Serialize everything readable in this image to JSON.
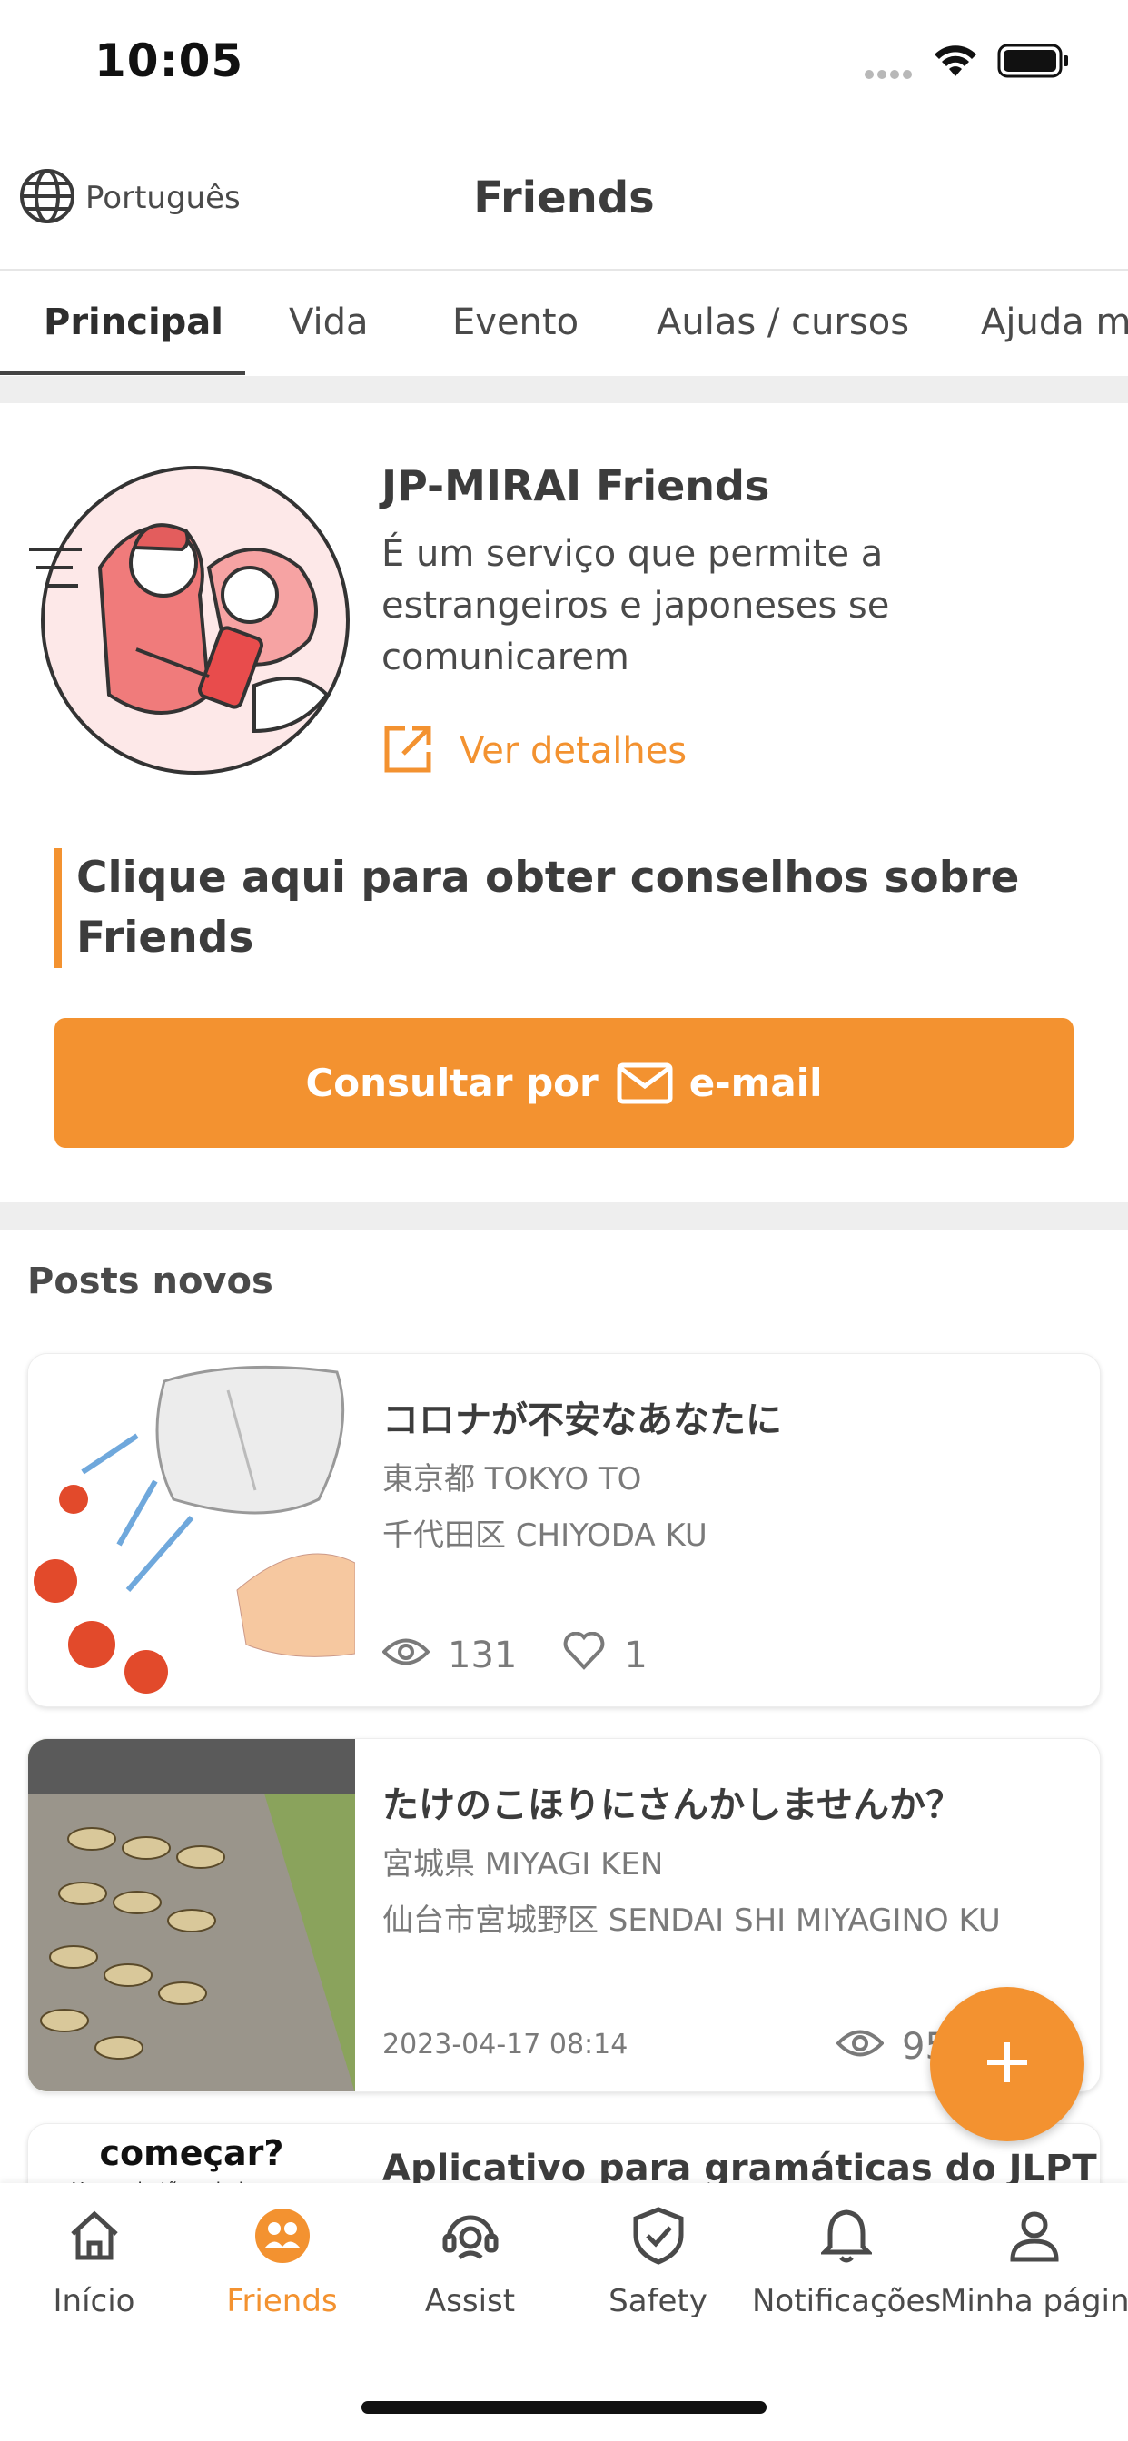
{
  "status_bar": {
    "time": "10:05"
  },
  "header": {
    "language_label": "Português",
    "title": "Friends"
  },
  "tabs": [
    {
      "label": "Principal",
      "active": true
    },
    {
      "label": "Vida",
      "active": false
    },
    {
      "label": "Evento",
      "active": false
    },
    {
      "label": "Aulas / cursos",
      "active": false
    },
    {
      "label": "Ajuda mu",
      "active": false
    }
  ],
  "intro": {
    "title": "JP-MIRAI Friends",
    "description": "É um serviço que permite a estrangeiros e japoneses se comunicarem",
    "details_link": "Ver detalhes"
  },
  "advice": {
    "text": "Clique aqui para obter conselhos sobre Friends"
  },
  "consult_button": {
    "prefix": "Consultar por",
    "suffix": "e-mail",
    "icon": "mail-icon"
  },
  "posts": {
    "section_title": "Posts novos",
    "items": [
      {
        "title": "コロナが不安なあなたに",
        "prefecture": "東京都 TOKYO TO",
        "city": "千代田区 CHIYODA KU",
        "views": "131",
        "likes": "1"
      },
      {
        "title": "たけのこほりにさんかしませんか？",
        "prefecture": "宮城県 MIYAGI KEN",
        "city": "仙台市宮城野区 SENDAI SHI MIYAGINO KU",
        "date": "2023-04-17 08:14",
        "views": "95"
      },
      {
        "title": "Aplicativo para gramáticas do  JLPT",
        "thumb_heading": "começar?",
        "thumb_sub": "Use os botões abaixo para"
      }
    ]
  },
  "fab": {
    "icon": "plus-icon"
  },
  "bottom_nav": [
    {
      "label": "Início",
      "icon": "home-icon",
      "active": false
    },
    {
      "label": "Friends",
      "icon": "friends-icon",
      "active": true
    },
    {
      "label": "Assist",
      "icon": "assist-icon",
      "active": false
    },
    {
      "label": "Safety",
      "icon": "shield-check-icon",
      "active": false
    },
    {
      "label": "Notificações",
      "icon": "bell-icon",
      "active": false
    },
    {
      "label": "Minha página",
      "icon": "user-icon",
      "active": false
    }
  ],
  "colors": {
    "accent": "#f39230",
    "text": "#3c3c3c",
    "muted": "#7a7a7a",
    "separator": "#eeeeee"
  }
}
